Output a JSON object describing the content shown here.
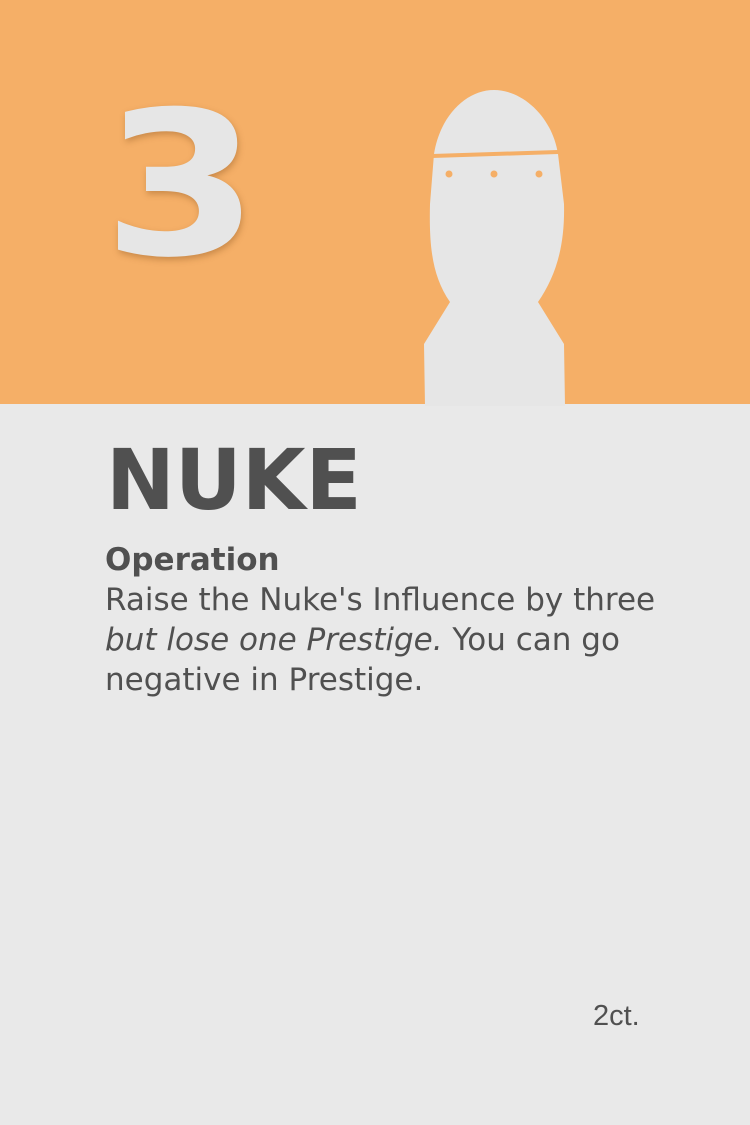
{
  "card": {
    "cost": "3",
    "title": "NUKE",
    "type_label": "Operation",
    "text": {
      "part1": "Raise the Nuke's Influence by three ",
      "part2_italic": "but lose one Prestige.",
      "part3": " You can go negative in Prestige."
    },
    "count": "2ct.",
    "illustration_icon": "nuke-bomb-icon"
  },
  "colors": {
    "banner": "#f5af67",
    "background": "#e9e9e9",
    "text": "#505050",
    "illustration": "#e6e6e6"
  }
}
